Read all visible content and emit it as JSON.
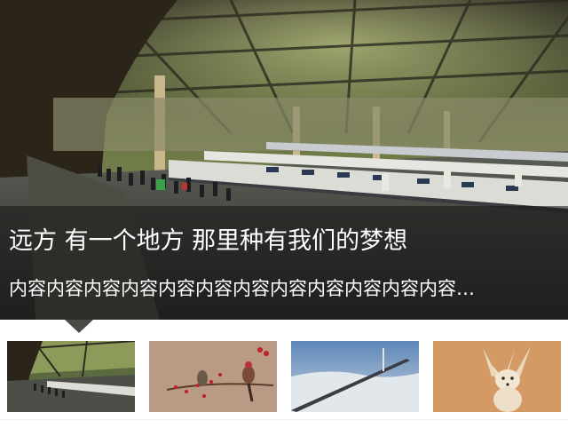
{
  "slider": {
    "active_index": 0,
    "slide": {
      "title": "远方 有一个地方 那里种有我们的梦想",
      "description": "内容内容内容内容内容内容内容内容内容内容内容内容…",
      "image_alt": "train-station"
    },
    "thumbnails": [
      {
        "image": "train-station-thumbnail",
        "active": true
      },
      {
        "image": "birds-on-branch-thumbnail",
        "active": false
      },
      {
        "image": "bridge-over-clouds-thumbnail",
        "active": false
      },
      {
        "image": "fennec-fox-thumbnail",
        "active": false
      }
    ],
    "colors": {
      "caption_bg": "#141414",
      "caption_text": "#ffffff",
      "pointer": "#4a4a46",
      "fox_bg": "#d49a65"
    }
  }
}
